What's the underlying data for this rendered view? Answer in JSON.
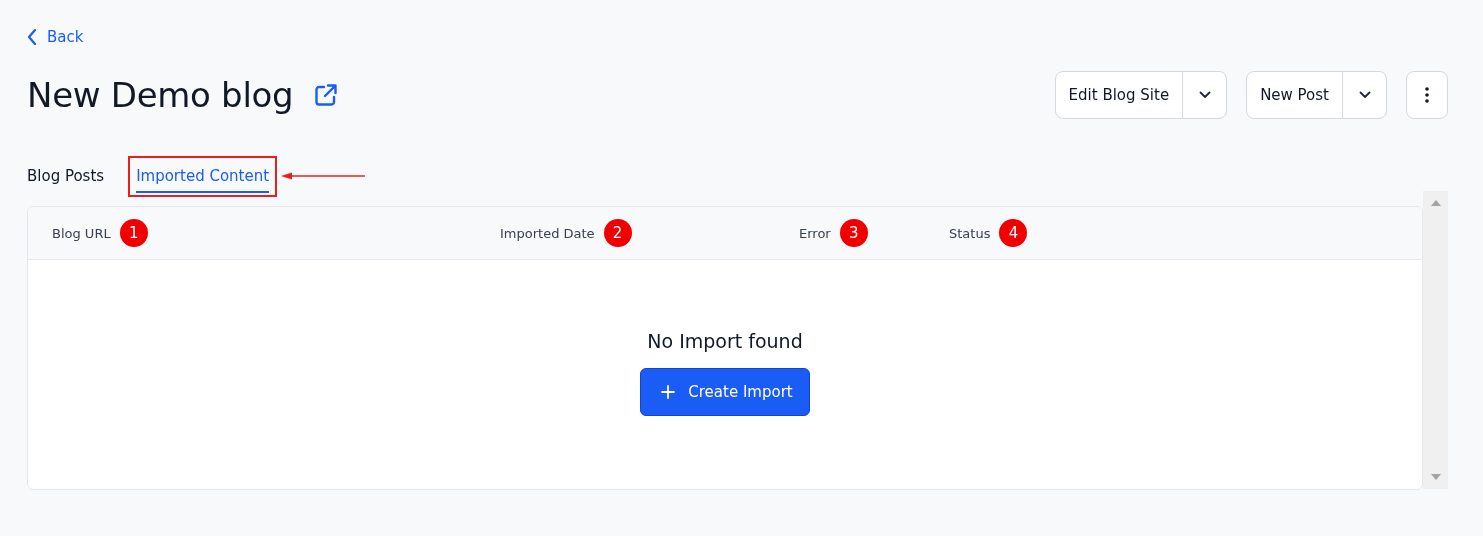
{
  "back_link": {
    "label": "Back"
  },
  "page_title": "New Demo blog",
  "header_buttons": [
    {
      "label": "Edit Blog Site",
      "kind": "split"
    },
    {
      "label": "New Post",
      "kind": "split"
    },
    {
      "kind": "more"
    }
  ],
  "tabs": [
    {
      "label": "Blog Posts",
      "selected": false,
      "highlighted": false
    },
    {
      "label": "Imported Content",
      "selected": true,
      "highlighted": true
    }
  ],
  "table": {
    "columns": [
      {
        "label": "Blog URL",
        "marker": "1"
      },
      {
        "label": "Imported Date",
        "marker": "2"
      },
      {
        "label": "Error",
        "marker": "3"
      },
      {
        "label": "Status",
        "marker": "4"
      }
    ],
    "empty_state": {
      "message": "No Import found",
      "button": "Create Import"
    }
  }
}
